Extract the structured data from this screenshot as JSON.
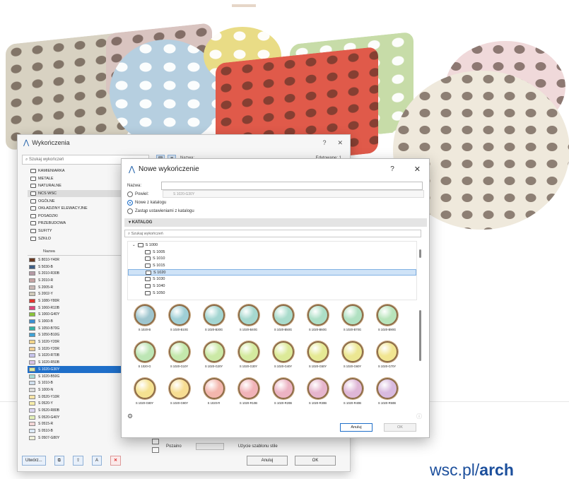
{
  "back_window": {
    "title": "Wykończenia",
    "search_placeholder": "Szukaj wykończeń",
    "col_name": "Nazwa:",
    "edit_count": "Edytowane: 1",
    "tree_items": [
      "KAMIENIARKA",
      "METALE",
      "NATURALNE",
      "NCS WSC",
      "OGÓLNE",
      "OKŁADZINY ELEWACYJNE",
      "POSADZKI",
      "PRZEBUDOWA",
      "SUFITY",
      "SZKŁO"
    ],
    "list_header": "Nazwa",
    "list_items": [
      {
        "name": "S 8010-Y40R",
        "color": "#6b3a22"
      },
      {
        "name": "S 5030-B",
        "color": "#3f5f86"
      },
      {
        "name": "S 2010-R30B",
        "color": "#b59aa5"
      },
      {
        "name": "S 2010-R",
        "color": "#c6a3a3"
      },
      {
        "name": "S 2005-R",
        "color": "#c9b9b6"
      },
      {
        "name": "S 2002-Y",
        "color": "#cfcab9"
      },
      {
        "name": "S 1080-Y80R",
        "color": "#e0352e"
      },
      {
        "name": "S 1060-R10B",
        "color": "#e0457a"
      },
      {
        "name": "S 1060-G40Y",
        "color": "#8bc43a"
      },
      {
        "name": "S 1060-B",
        "color": "#3b8fd1"
      },
      {
        "name": "S 1050-B70G",
        "color": "#36b2a6"
      },
      {
        "name": "S 1050-B10G",
        "color": "#3fa3d6"
      },
      {
        "name": "S 1020-Y20R",
        "color": "#f2d58a"
      },
      {
        "name": "S 1020-Y20R",
        "color": "#f0cf96"
      },
      {
        "name": "S 1020-R70B",
        "color": "#c7c3ec"
      },
      {
        "name": "S 1020-R50B",
        "color": "#d9c3e8"
      },
      {
        "name": "S 1020-G30Y",
        "color": "#d7e8a4"
      },
      {
        "name": "S 1020-B50G",
        "color": "#a8dcd6"
      },
      {
        "name": "S 1010-B",
        "color": "#d0dfee"
      },
      {
        "name": "S 1000-N",
        "color": "#dcdcdc"
      },
      {
        "name": "S 0520-Y10R",
        "color": "#f7e4a6"
      },
      {
        "name": "S 0520-Y",
        "color": "#f7eeaa"
      },
      {
        "name": "S 0520-R80B",
        "color": "#dcd7f3"
      },
      {
        "name": "S 0520-G40Y",
        "color": "#e3f0b9"
      },
      {
        "name": "S 0515-R",
        "color": "#f3d6d6"
      },
      {
        "name": "S 0510-B",
        "color": "#dce9f5"
      },
      {
        "name": "S 0507-G80Y",
        "color": "#eeefd9"
      }
    ],
    "selected_index": 16,
    "bottom_new": "Utwórz...",
    "bottom_a": "A",
    "bottom_x": "✕",
    "field_label": "Pozaino",
    "field_label2": "Użycie szablonu stile",
    "ok": "Anuluj",
    "cancel": "OK"
  },
  "dialog": {
    "title": "Nowe wykończenie",
    "help": "?",
    "close": "✕",
    "name_label": "Nazwa:",
    "radio1": "Powiel:",
    "radio1_value": "S 1020-G30Y",
    "radio2": "Nowe z katalogu",
    "radio3": "Zastąp ustawieniami z katalogu",
    "catalog_label": "KATALOG",
    "search_placeholder": "Szukaj wykończeń",
    "tree_root": "S 1000",
    "tree_items": [
      "S 1000",
      "S 1005",
      "S 1010",
      "S 1015",
      "S 1020",
      "S 1030",
      "S 1040",
      "S 1050"
    ],
    "tree_selected": 4,
    "swatches": [
      {
        "name": "S 1020-B",
        "color": "#9fc6cf"
      },
      {
        "name": "S 1020-B10G",
        "color": "#9fcfd6"
      },
      {
        "name": "S 1020-B30G",
        "color": "#a4d6d2"
      },
      {
        "name": "S 1020-B40G",
        "color": "#a6d8cf"
      },
      {
        "name": "S 1020-B50G",
        "color": "#aadccc"
      },
      {
        "name": "S 1020-B60G",
        "color": "#addfc7"
      },
      {
        "name": "S 1020-B70G",
        "color": "#b1e1c2"
      },
      {
        "name": "S 1020-B90G",
        "color": "#b8e4bb"
      },
      {
        "name": "S 1020-G",
        "color": "#bde6b5"
      },
      {
        "name": "S 1020-G10Y",
        "color": "#c4e8ac"
      },
      {
        "name": "S 1020-G20Y",
        "color": "#cbe9a6"
      },
      {
        "name": "S 1020-G30Y",
        "color": "#d4ea9f"
      },
      {
        "name": "S 1020-G40Y",
        "color": "#dcea98"
      },
      {
        "name": "S 1020-G50Y",
        "color": "#e5e994"
      },
      {
        "name": "S 1020-G60Y",
        "color": "#ece792"
      },
      {
        "name": "S 1020-G70Y",
        "color": "#f1e591"
      },
      {
        "name": "S 1020-G80Y",
        "color": "#f5e291"
      },
      {
        "name": "S 1020-G90Y",
        "color": "#f7dd92"
      },
      {
        "name": "S 1020-R",
        "color": "#f3b6ad"
      },
      {
        "name": "S 1020-R10B",
        "color": "#f1b3b8"
      },
      {
        "name": "S 1020-R20B",
        "color": "#ecb3c3"
      },
      {
        "name": "S 1020-R30B",
        "color": "#e6b5cd"
      },
      {
        "name": "S 1020-R40B",
        "color": "#dfb7d7"
      },
      {
        "name": "S 1020-R50B",
        "color": "#d8badf"
      }
    ],
    "ok": "Anuluj",
    "cancel": "OK"
  },
  "brand": {
    "plain": "wsc.pl/",
    "bold": "arch"
  }
}
